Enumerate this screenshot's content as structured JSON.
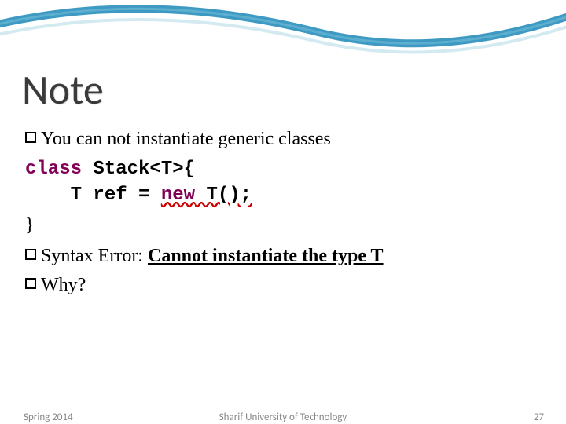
{
  "title": "Note",
  "bullets": {
    "b1": "You can not  instantiate generic classes",
    "b2_prefix": "Syntax Error: ",
    "b2_bold": "Cannot instantiate the type T",
    "b3": "Why?"
  },
  "code": {
    "kw_class": "class",
    "stack_decl": " Stack<T>{",
    "indent": "    T ref = ",
    "kw_new": "new",
    "new_call": " T();",
    "close": "}"
  },
  "footer": {
    "left": "Spring 2014",
    "center": "Sharif University of Technology",
    "right": "27"
  }
}
